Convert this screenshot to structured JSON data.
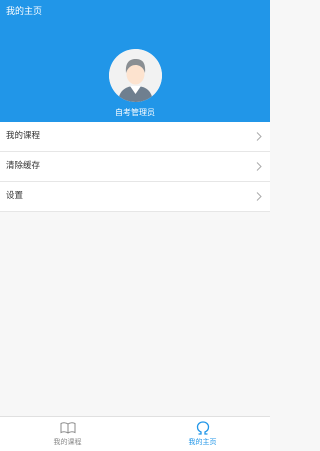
{
  "header": {
    "title": "我的主页",
    "username": "自考管理员",
    "bg_color": "#2196e8"
  },
  "menu": {
    "items": [
      {
        "label": "我的课程",
        "icon": "chevron-right-icon"
      },
      {
        "label": "清除缓存",
        "icon": "chevron-right-icon"
      },
      {
        "label": "设置",
        "icon": "chevron-right-icon"
      }
    ]
  },
  "tabbar": {
    "tabs": [
      {
        "label": "我的课程",
        "icon": "open-book-icon",
        "active": false
      },
      {
        "label": "我的主页",
        "icon": "omega-icon",
        "active": true
      }
    ],
    "active_color": "#2196e8",
    "inactive_color": "#888888"
  }
}
